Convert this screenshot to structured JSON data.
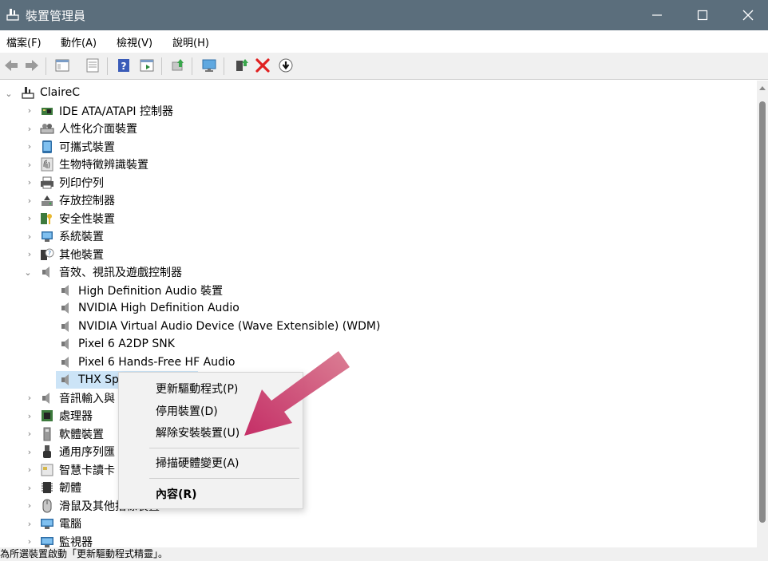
{
  "window": {
    "title": "裝置管理員"
  },
  "menubar": {
    "items": [
      "檔案(F)",
      "動作(A)",
      "檢視(V)",
      "說明(H)"
    ]
  },
  "tree": {
    "root": "ClaireC",
    "categories": [
      {
        "label": "IDE ATA/ATAPI 控制器",
        "icon": "ide-controller-icon"
      },
      {
        "label": "人性化介面裝置",
        "icon": "hid-icon"
      },
      {
        "label": "可攜式裝置",
        "icon": "portable-device-icon"
      },
      {
        "label": "生物特徵辨識裝置",
        "icon": "fingerprint-icon"
      },
      {
        "label": "列印佇列",
        "icon": "printer-icon"
      },
      {
        "label": "存放控制器",
        "icon": "storage-controller-icon"
      },
      {
        "label": "安全性裝置",
        "icon": "security-key-icon"
      },
      {
        "label": "系統裝置",
        "icon": "system-device-icon"
      },
      {
        "label": "其他裝置",
        "icon": "unknown-device-icon"
      },
      {
        "label": "音效、視訊及遊戲控制器",
        "icon": "speaker-icon",
        "expanded": true
      }
    ],
    "audio_children": [
      "High Definition Audio 裝置",
      "NVIDIA High Definition Audio",
      "NVIDIA Virtual Audio Device (Wave Extensible) (WDM)",
      "Pixel 6 A2DP SNK",
      "Pixel 6 Hands-Free HF Audio",
      "THX Sp"
    ],
    "more_categories": [
      {
        "label": "音訊輸入與",
        "icon": "speaker-icon"
      },
      {
        "label": "處理器",
        "icon": "processor-icon"
      },
      {
        "label": "軟體裝置",
        "icon": "software-device-icon"
      },
      {
        "label": "通用序列匯",
        "icon": "usb-icon"
      },
      {
        "label": "智慧卡讀卡",
        "icon": "smartcard-icon"
      },
      {
        "label": "韌體",
        "icon": "firmware-icon"
      },
      {
        "label": "滑鼠及其他指標裝置",
        "icon": "mouse-icon"
      },
      {
        "label": "電腦",
        "icon": "computer-icon"
      },
      {
        "label": "監視器",
        "icon": "monitor-icon"
      }
    ]
  },
  "context_menu": {
    "items": [
      "更新驅動程式(P)",
      "停用裝置(D)",
      "解除安裝裝置(U)",
      "掃描硬體變更(A)",
      "內容(R)"
    ]
  },
  "statusbar": {
    "text": "為所選裝置啟動「更新驅動程式精靈」。"
  },
  "colors": {
    "titlebar": "#5b6e7c",
    "selection": "#cce4f7",
    "arrow": "#c2245f"
  }
}
